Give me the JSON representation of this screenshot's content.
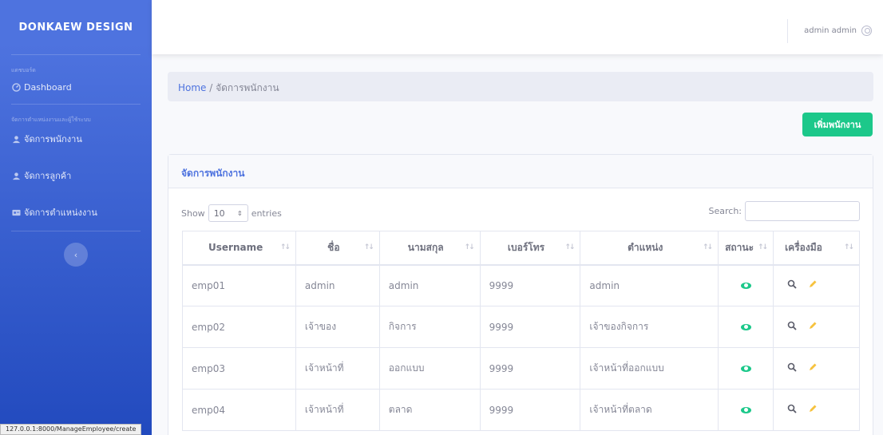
{
  "sidebar": {
    "brand": "DONKAEW DESIGN",
    "heading1": "แดชบอร์ด",
    "dashboard": "Dashboard",
    "heading2": "จัดการตำแหน่งงานและผู้ใช้ระบบ",
    "items": [
      {
        "label": "จัดการพนักงาน",
        "icon": "user-icon"
      },
      {
        "label": "จัดการลูกค้า",
        "icon": "user-icon"
      },
      {
        "label": "จัดการตำแหน่งงาน",
        "icon": "id-card-icon"
      }
    ],
    "toggle": "‹"
  },
  "statusbar": {
    "url": "127.0.0.1:8000/ManageEmployee/create"
  },
  "topbar": {
    "user": "admin admin"
  },
  "breadcrumb": {
    "home": "Home",
    "sep": " / ",
    "current": "จัดการพนักงาน"
  },
  "actions": {
    "add_employee": "เพิ่มพนักงาน"
  },
  "card": {
    "title": "จัดการพนักงาน",
    "show_label": "Show",
    "entries_value": "10",
    "entries_label": "entries",
    "search_label": "Search:"
  },
  "table": {
    "headers": [
      "Username",
      "ชื่อ",
      "นามสกุล",
      "เบอร์โทร",
      "ตำแหน่ง",
      "สถานะ",
      "เครื่องมือ"
    ],
    "rows": [
      [
        "emp01",
        "admin",
        "admin",
        "9999",
        "admin"
      ],
      [
        "emp02",
        "เจ้าของ",
        "กิจการ",
        "9999",
        "เจ้าของกิจการ"
      ],
      [
        "emp03",
        "เจ้าหน้าที่",
        "ออกแบบ",
        "9999",
        "เจ้าหน้าที่ออกแบบ"
      ],
      [
        "emp04",
        "เจ้าหน้าที่",
        "ตลาด",
        "9999",
        "เจ้าหน้าที่ตลาด"
      ]
    ]
  },
  "colors": {
    "primary": "#4e73df",
    "success": "#1cc88a",
    "warning": "#f6c23e"
  }
}
